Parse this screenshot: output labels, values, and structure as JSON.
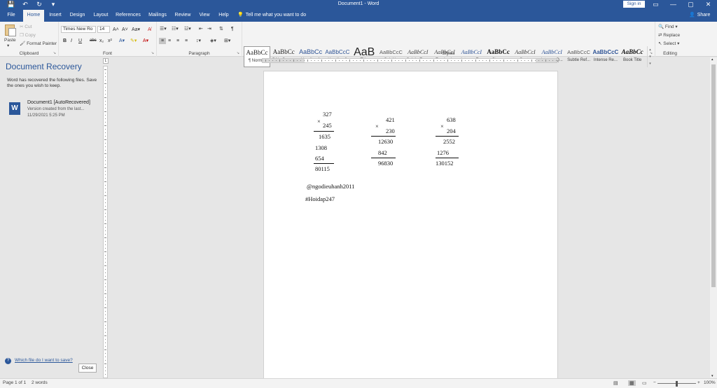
{
  "titlebar": {
    "document_title": "Document1 - Word",
    "signin": "Sign in",
    "qat": [
      "💾",
      "↶",
      "↻",
      "▾"
    ],
    "window_buttons": [
      "▭",
      "—",
      "▢",
      "✕"
    ]
  },
  "tabs": [
    "File",
    "Home",
    "Insert",
    "Design",
    "Layout",
    "References",
    "Mailings",
    "Review",
    "View",
    "Help"
  ],
  "active_tab": "Home",
  "tell_me": "Tell me what you want to do",
  "share": "Share",
  "clipboard": {
    "paste": "Paste",
    "cut": "Cut",
    "copy": "Copy",
    "format_painter": "Format Painter",
    "label": "Clipboard"
  },
  "font": {
    "name": "Times New Ro",
    "size": "14",
    "label": "Font",
    "buttons": [
      "B",
      "I",
      "U",
      "abc",
      "x₂",
      "x²"
    ]
  },
  "paragraph": {
    "label": "Paragraph"
  },
  "styles": {
    "label": "Styles",
    "items": [
      {
        "sample": "AaBbCc",
        "name": "¶ Normal"
      },
      {
        "sample": "AaBbCc",
        "name": "¶ No Spac..."
      },
      {
        "sample": "AaBbCc",
        "name": "Heading 1"
      },
      {
        "sample": "AaBbCcC",
        "name": "Heading 2"
      },
      {
        "sample": "AaB",
        "name": "Title"
      },
      {
        "sample": "AaBbCcC",
        "name": "Subtitle"
      },
      {
        "sample": "AaBbCcI",
        "name": "Subtle Em..."
      },
      {
        "sample": "AaBbCcI",
        "name": "Emphasis"
      },
      {
        "sample": "AaBbCcI",
        "name": "Intense E..."
      },
      {
        "sample": "AaBbCc",
        "name": "Strong"
      },
      {
        "sample": "AaBbCcI",
        "name": "Quote"
      },
      {
        "sample": "AaBbCcI",
        "name": "Intense Q..."
      },
      {
        "sample": "AaBbCcC",
        "name": "Subtle Ref..."
      },
      {
        "sample": "AaBbCcC",
        "name": "Intense Re..."
      },
      {
        "sample": "AaBbCc",
        "name": "Book Title"
      }
    ]
  },
  "editing": {
    "find": "Find",
    "replace": "Replace",
    "select": "Select",
    "label": "Editing"
  },
  "recovery": {
    "title": "Document Recovery",
    "desc": "Word has recovered the following files. Save the ones you wish to keep.",
    "file_name": "Document1  [AutoRecovered]",
    "file_desc": "Version created from the last...",
    "file_time": "11/29/2021 5:25 PM",
    "help": "Which file do I want to save?",
    "close": "Close"
  },
  "document": {
    "calc1": {
      "a": "327",
      "b": "245",
      "p1": "1635",
      "p2": "1308",
      "p3": "654",
      "result": "80115",
      "op": "×"
    },
    "calc2": {
      "a": "421",
      "b": "230",
      "p1": "12630",
      "p2": "842",
      "result": "96830",
      "op": "×"
    },
    "calc3": {
      "a": "638",
      "b": "204",
      "p1": "2552",
      "p2": "1276",
      "result": "130152",
      "op": "×"
    },
    "handle": "@ngodieuhanh2011",
    "tag": "#Hoidap247"
  },
  "status": {
    "page": "Page 1 of 1",
    "words": "2 words",
    "zoom": "100%"
  }
}
